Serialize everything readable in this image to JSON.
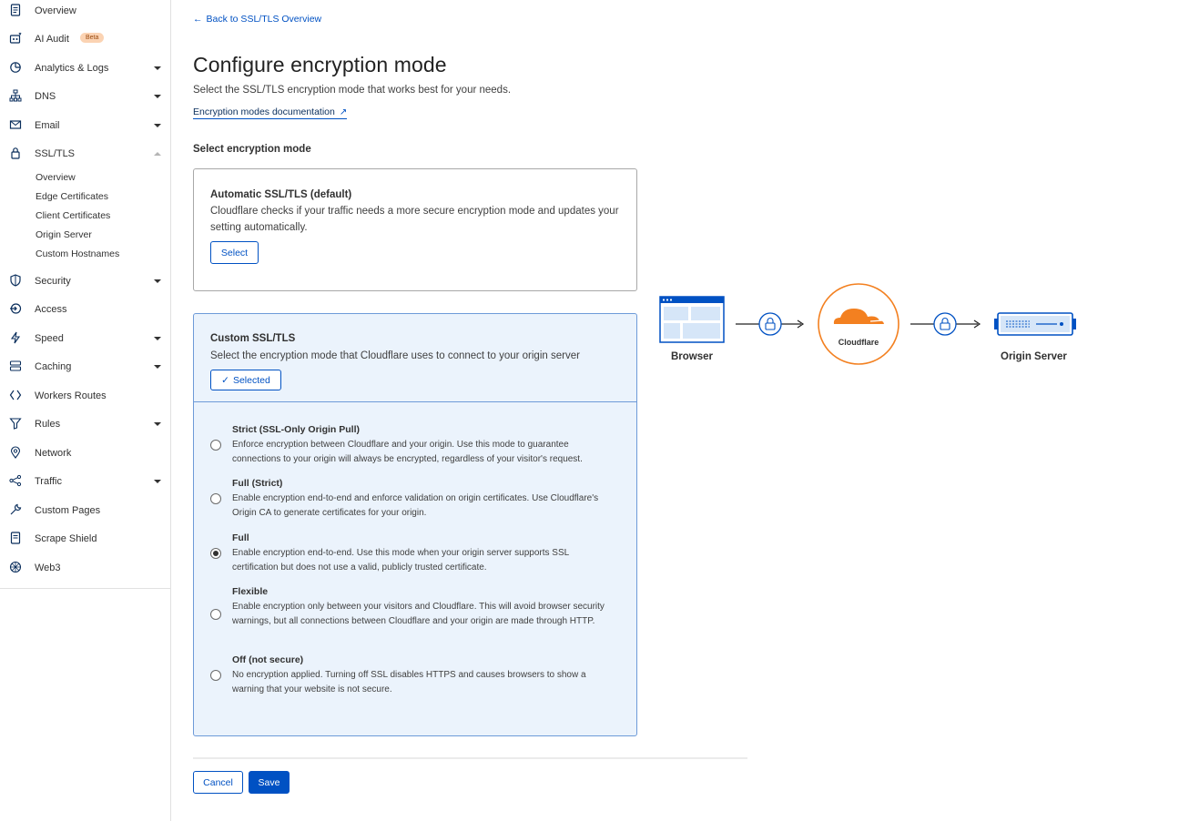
{
  "sidebar": {
    "items": [
      {
        "label": "Overview",
        "icon": "document-icon"
      },
      {
        "label": "AI Audit",
        "icon": "robot-icon",
        "badge": "Beta"
      },
      {
        "label": "Analytics & Logs",
        "icon": "chart-pie-icon"
      },
      {
        "label": "DNS",
        "icon": "network-tree-icon"
      },
      {
        "label": "Email",
        "icon": "envelope-icon"
      },
      {
        "label": "SSL/TLS",
        "icon": "lock-icon"
      },
      {
        "label": "Security",
        "icon": "shield-icon"
      },
      {
        "label": "Access",
        "icon": "access-icon"
      },
      {
        "label": "Speed",
        "icon": "lightning-icon"
      },
      {
        "label": "Caching",
        "icon": "database-icon"
      },
      {
        "label": "Workers Routes",
        "icon": "workers-icon"
      },
      {
        "label": "Rules",
        "icon": "funnel-icon"
      },
      {
        "label": "Network",
        "icon": "location-pin-icon"
      },
      {
        "label": "Traffic",
        "icon": "share-nodes-icon"
      },
      {
        "label": "Custom Pages",
        "icon": "wrench-icon"
      },
      {
        "label": "Scrape Shield",
        "icon": "document-shield-icon"
      },
      {
        "label": "Web3",
        "icon": "web3-icon"
      }
    ],
    "ssl_sub_items": [
      "Overview",
      "Edge Certificates",
      "Client Certificates",
      "Origin Server",
      "Custom Hostnames"
    ]
  },
  "main": {
    "back_link": "Back to SSL/TLS Overview",
    "title": "Configure encryption mode",
    "subtitle": "Select the SSL/TLS encryption mode that works best for your needs.",
    "doc_link": "Encryption modes documentation",
    "section_title": "Select encryption mode",
    "auto_card": {
      "title": "Automatic SSL/TLS (default)",
      "description": "Cloudflare checks if your traffic needs a more secure encryption mode and updates your setting automatically.",
      "button": "Select"
    },
    "custom_card": {
      "title": "Custom SSL/TLS",
      "description": "Select the encryption mode that Cloudflare uses to connect to your origin server",
      "button": "Selected",
      "options": [
        {
          "title": "Strict (SSL-Only Origin Pull)",
          "description": "Enforce encryption between Cloudflare and your origin. Use this mode to guarantee connections to your origin will always be encrypted, regardless of your visitor's request.",
          "checked": false
        },
        {
          "title": "Full (Strict)",
          "description": "Enable encryption end-to-end and enforce validation on origin certificates. Use Cloudflare's Origin CA to generate certificates for your origin.",
          "checked": false
        },
        {
          "title": "Full",
          "description": "Enable encryption end-to-end. Use this mode when your origin server supports SSL certification but does not use a valid, publicly trusted certificate.",
          "checked": true
        },
        {
          "title": "Flexible",
          "description": "Enable encryption only between your visitors and Cloudflare. This will avoid browser security warnings, but all connections between Cloudflare and your origin are made through HTTP.",
          "checked": false
        },
        {
          "title": "Off (not secure)",
          "description": "No encryption applied. Turning off SSL disables HTTPS and causes browsers to show a warning that your website is not secure.",
          "checked": false
        }
      ]
    },
    "cancel_button": "Cancel",
    "save_button": "Save"
  },
  "diagram": {
    "browser_label": "Browser",
    "cloudflare_label": "Cloudflare",
    "origin_label": "Origin Server",
    "colors": {
      "accent_blue": "#0051c3",
      "cloudflare_orange": "#f38020"
    }
  }
}
